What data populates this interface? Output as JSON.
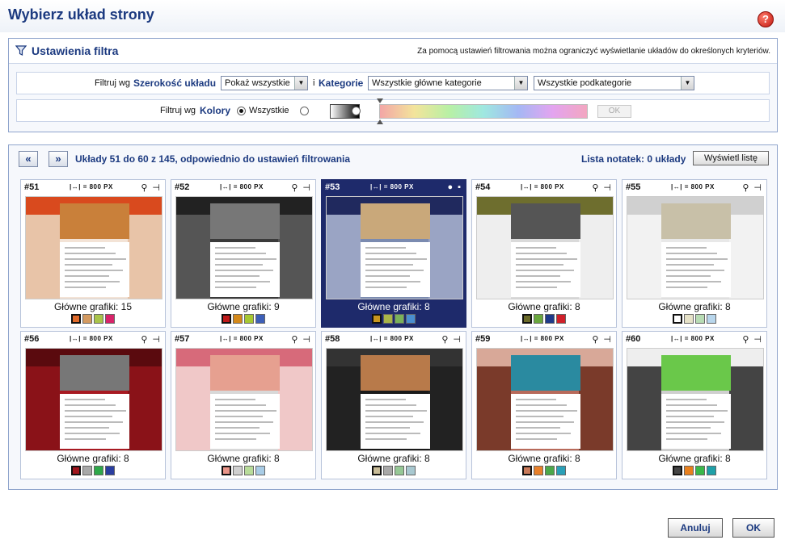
{
  "window": {
    "title": "Wybierz układ strony",
    "help_icon": "?"
  },
  "filter": {
    "title": "Ustawienia filtra",
    "hint": "Za pomocą ustawień filtrowania można ograniczyć wyświetlanie układów do określonych kryteriów.",
    "row1": {
      "prefix": "Filtruj wg",
      "width_label": "Szerokość układu",
      "width_value": "Pokaż wszystkie",
      "and": "i",
      "category_label": "Kategorie",
      "category_value": "Wszystkie główne kategorie",
      "subcategory_value": "Wszystkie podkategorie"
    },
    "row2": {
      "prefix": "Filtruj wg",
      "color_label": "Kolory",
      "all_option": "Wszystkie",
      "selected": "all",
      "ok_label": "OK"
    }
  },
  "list": {
    "prev_label": "«",
    "next_label": "»",
    "range_text": "Układy 51 do 60 z 145, odpowiednio do ustawień filtrowania",
    "notes_text": "Lista notatek: 0 układy",
    "show_list_label": "Wyświetl listę",
    "width_text": "|↔| = 800 PX",
    "items": [
      {
        "num": "#51",
        "label": "Główne grafiki: 15",
        "selected": false,
        "swatches": [
          "#e06a2a",
          "#d49a60",
          "#a9c44a",
          "#d8246a"
        ]
      },
      {
        "num": "#52",
        "label": "Główne grafiki: 9",
        "selected": false,
        "swatches": [
          "#c01a1a",
          "#d4891a",
          "#a6c832",
          "#3d5fb8"
        ]
      },
      {
        "num": "#53",
        "label": "Główne grafiki: 8",
        "selected": true,
        "swatches": [
          "#c8961e",
          "#a9b548",
          "#7ab25a",
          "#4a8fd0"
        ]
      },
      {
        "num": "#54",
        "label": "Główne grafiki: 8",
        "selected": false,
        "swatches": [
          "#6b6b2a",
          "#6aa83e",
          "#1e3a8a",
          "#d0202a"
        ]
      },
      {
        "num": "#55",
        "label": "Główne grafiki: 8",
        "selected": false,
        "swatches": [
          "#ffffff",
          "#e6e2c8",
          "#b8dcb4",
          "#b8d6ec"
        ]
      },
      {
        "num": "#56",
        "label": "Główne grafiki: 8",
        "selected": false,
        "swatches": [
          "#a0161e",
          "#a8a8a8",
          "#2ea84a",
          "#2a3ea0"
        ]
      },
      {
        "num": "#57",
        "label": "Główne grafiki: 8",
        "selected": false,
        "swatches": [
          "#e89488",
          "#cfcfcf",
          "#b8dc9a",
          "#a8cce6"
        ]
      },
      {
        "num": "#58",
        "label": "Główne grafiki: 8",
        "selected": false,
        "swatches": [
          "#c8bc98",
          "#a8a8a8",
          "#96c896",
          "#a8c8d0"
        ]
      },
      {
        "num": "#59",
        "label": "Główne grafiki: 8",
        "selected": false,
        "swatches": [
          "#c87a5a",
          "#e8802a",
          "#4ca84a",
          "#2aa0b8"
        ]
      },
      {
        "num": "#60",
        "label": "Główne grafiki: 8",
        "selected": false,
        "swatches": [
          "#444444",
          "#e8801e",
          "#3ab84a",
          "#1ea0a8"
        ]
      }
    ]
  },
  "footer": {
    "cancel_label": "Anuluj",
    "ok_label": "OK"
  },
  "colors": {
    "accent": "#1c3a80",
    "selected_card": "#1e2a6b"
  }
}
